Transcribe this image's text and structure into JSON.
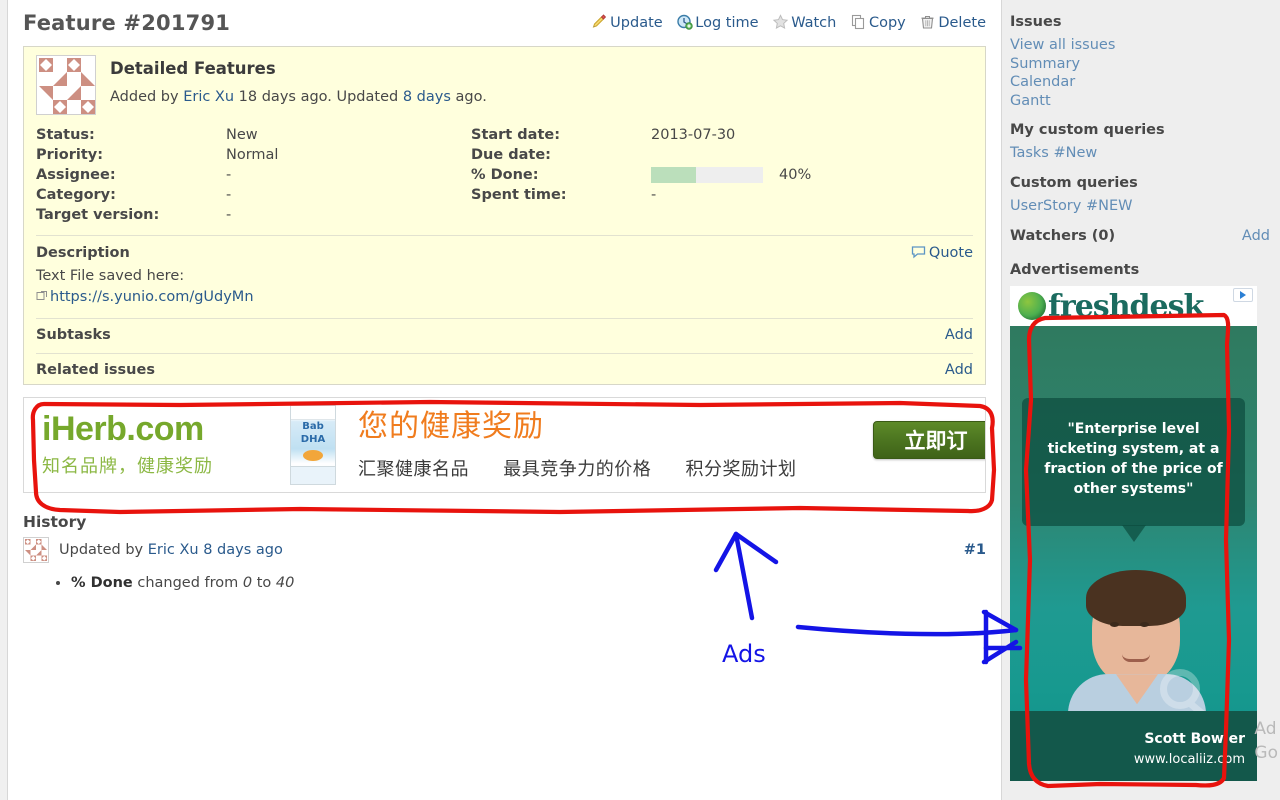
{
  "issue": {
    "title": "Feature #201791",
    "subject": "Detailed Features",
    "author_prefix": "Added by ",
    "author": "Eric Xu",
    "author_suffix": " 18 days ago. Updated ",
    "updated_ago": "8 days",
    "author_end": " ago."
  },
  "contextual": {
    "update": "Update",
    "log_time": "Log time",
    "watch": "Watch",
    "copy": "Copy",
    "delete": "Delete"
  },
  "attributes": {
    "status_label": "Status:",
    "status_value": "New",
    "priority_label": "Priority:",
    "priority_value": "Normal",
    "assignee_label": "Assignee:",
    "assignee_value": "-",
    "category_label": "Category:",
    "category_value": "-",
    "target_version_label": "Target version:",
    "target_version_value": "-",
    "start_date_label": "Start date:",
    "start_date_value": "2013-07-30",
    "due_date_label": "Due date:",
    "due_date_value": "",
    "done_label": "% Done:",
    "done_value": "40%",
    "done_percent": 40,
    "spent_time_label": "Spent time:",
    "spent_time_value": "-"
  },
  "description": {
    "heading": "Description",
    "quote_label": "Quote",
    "line1": "Text File saved here:",
    "link": "https://s.yunio.com/gUdyMn"
  },
  "subtasks": {
    "heading": "Subtasks",
    "add_label": "Add"
  },
  "related_issues": {
    "heading": "Related issues",
    "add_label": "Add"
  },
  "banner_ad": {
    "brand": "iHerb.com",
    "brand_tagline": "知名品牌，健康奖励",
    "product_line1": "Bab",
    "product_line2": "DHA",
    "headline": "您的健康奖励",
    "sub1": "汇聚健康名品",
    "sub2": "最具竞争力的价格",
    "sub3": "积分奖励计划",
    "cta": "立即订",
    "brand_color": "#76a82c",
    "headline_color": "#f07c1e"
  },
  "history": {
    "heading": "History",
    "entry_prefix": "Updated by ",
    "entry_author": "Eric Xu",
    "entry_time": " 8 days ago",
    "anchor": "#1",
    "detail_property": "% Done",
    "detail_mid": " changed from ",
    "detail_old": "0",
    "detail_join": " to ",
    "detail_new": "40"
  },
  "sidebar": {
    "issues_heading": "Issues",
    "issues_links": [
      "View all issues",
      "Summary",
      "Calendar",
      "Gantt"
    ],
    "my_queries_heading": "My custom queries",
    "my_queries_links": [
      "Tasks #New"
    ],
    "custom_queries_heading": "Custom queries",
    "custom_queries_links": [
      "UserStory #NEW"
    ],
    "watchers_heading": "Watchers (0)",
    "watchers_add": "Add",
    "advertisements_heading": "Advertisements"
  },
  "sidebar_ad": {
    "logo_text": "freshdesk",
    "quote": "\"Enterprise level ticketing system, at a fraction of the price of other systems\"",
    "person_name": "Scott Bowler",
    "person_url": "www.localiiz.com",
    "adchoices_line1": "Ad",
    "adchoices_line2": "Go"
  },
  "annotations": {
    "ads_label": "Ads",
    "highlight_color": "#e8130d",
    "arrow_color": "#1414e6"
  }
}
